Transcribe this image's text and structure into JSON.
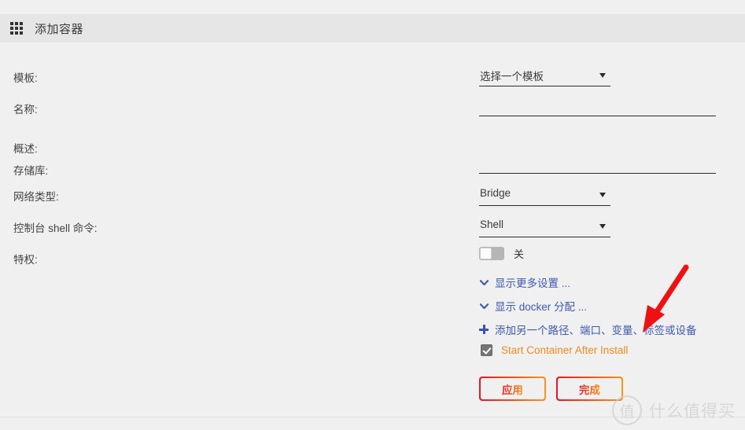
{
  "window": {
    "title": "添加容器",
    "icon": "grid-icon"
  },
  "form": {
    "rows": [
      {
        "label": "模板:",
        "type": "select",
        "value": "选择一个模板"
      },
      {
        "label": "名称:",
        "type": "text",
        "value": "",
        "placeholder": ""
      },
      {
        "label": "概述:",
        "type": "static",
        "value": ""
      },
      {
        "label": "存储库:",
        "type": "text",
        "value": "",
        "placeholder": ""
      },
      {
        "label": "网络类型:",
        "type": "select",
        "value": "Bridge"
      },
      {
        "label": "控制台 shell 命令:",
        "type": "select",
        "value": "Shell"
      },
      {
        "label": "特权:",
        "type": "toggle",
        "value": "关",
        "checked": false
      }
    ],
    "links": [
      {
        "icon": "chevron-down-icon",
        "label": "显示更多设置 ..."
      },
      {
        "icon": "chevron-down-icon",
        "label": "显示 docker 分配 ..."
      },
      {
        "icon": "plus-icon",
        "label": "添加另一个路径、端口、变量、标签或设备"
      }
    ],
    "checkbox": {
      "label": "Start Container After Install",
      "checked": true
    },
    "buttons": [
      {
        "label": "应用"
      },
      {
        "label": "完成"
      }
    ]
  },
  "annotation": {
    "type": "arrow",
    "color": "#ee1111"
  },
  "watermark": {
    "badge": "值",
    "text": "什么值得买"
  },
  "colors": {
    "page_background": "#f0f0f0",
    "titlebar_background": "#e6e6e6",
    "link": "#4059ad",
    "checkbox_label": "#e88c22",
    "button_gradient_start": "#e2162a",
    "button_gradient_end": "#f7941e",
    "annotation": "#ee1111"
  }
}
